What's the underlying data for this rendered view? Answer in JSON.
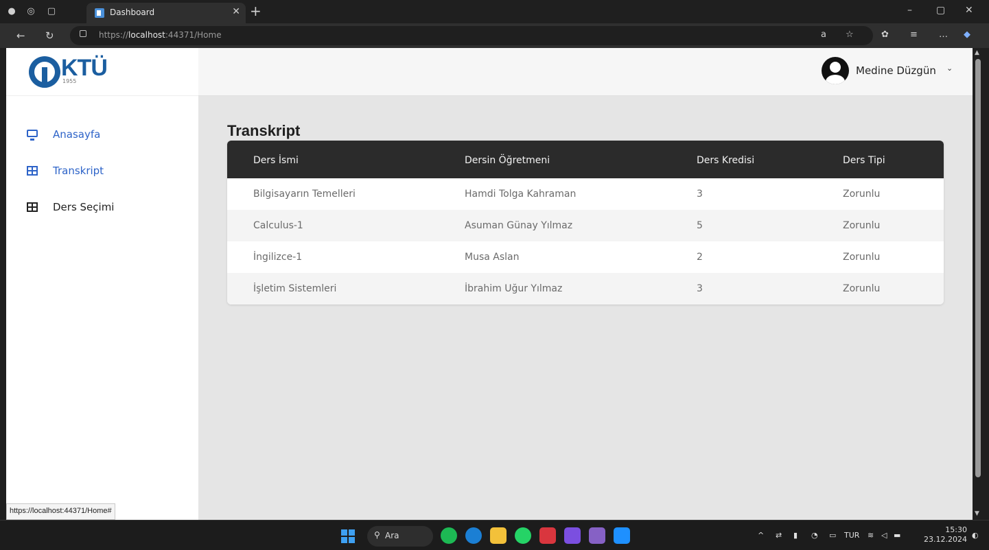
{
  "browser": {
    "tab_title": "Dashboard",
    "url_prefix": "https://",
    "url_host": "localhost",
    "url_path": ":44371/Home",
    "status_url": "https://localhost:44371/Home#"
  },
  "sidebar": {
    "logo_text": "KTÜ",
    "logo_year": "1955",
    "items": [
      {
        "label": "Anasayfa",
        "icon": "monitor-icon",
        "color": "#2d63c8"
      },
      {
        "label": "Transkript",
        "icon": "table-icon",
        "color": "#2d63c8"
      },
      {
        "label": "Ders Seçimi",
        "icon": "table-icon",
        "color": "#222222"
      }
    ]
  },
  "header": {
    "user_name": "Medine Düzgün",
    "chevron": "⌄"
  },
  "main": {
    "title": "Transkript",
    "columns": [
      "Ders İsmi",
      "Dersin Öğretmeni",
      "Ders Kredisi",
      "Ders Tipi"
    ],
    "rows": [
      [
        "Bilgisayarın Temelleri",
        "Hamdi Tolga Kahraman",
        "3",
        "Zorunlu"
      ],
      [
        "Calculus-1",
        "Asuman Günay Yılmaz",
        "5",
        "Zorunlu"
      ],
      [
        "İngilizce-1",
        "Musa Aslan",
        "2",
        "Zorunlu"
      ],
      [
        "İşletim Sistemleri",
        "İbrahim Uğur Yılmaz",
        "3",
        "Zorunlu"
      ]
    ]
  },
  "taskbar": {
    "search_label": "Ara",
    "lang": "TUR",
    "time": "15:30",
    "date": "23.12.2024"
  },
  "colors": {
    "header_bg": "#2b2b2b",
    "accent": "#2d63c8",
    "logo": "#1b5ea0"
  }
}
